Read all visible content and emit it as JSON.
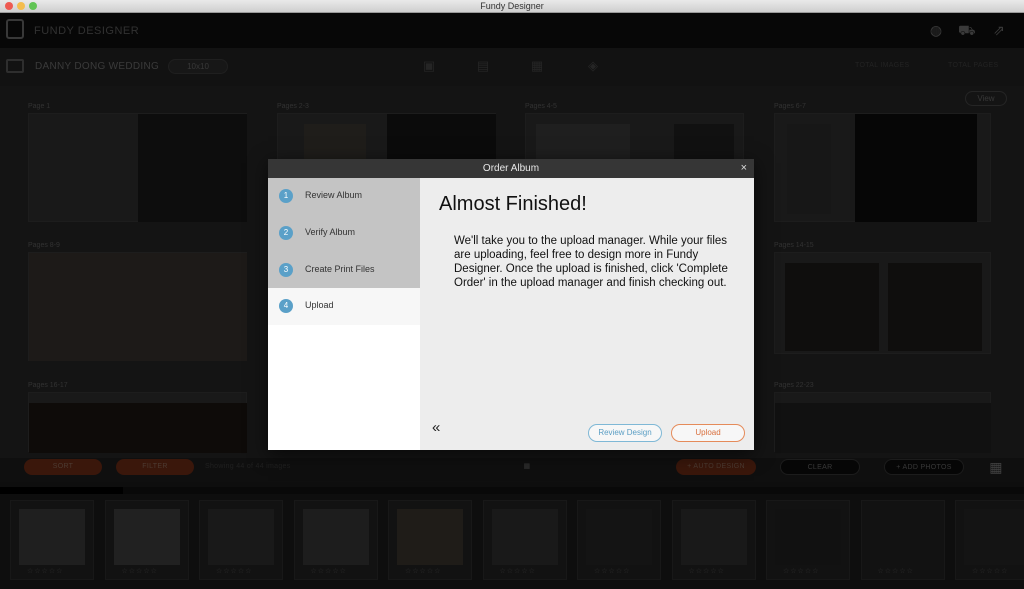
{
  "window": {
    "title": "Fundy Designer"
  },
  "appbar": {
    "brand": "FUNDY DESIGNER"
  },
  "project": {
    "name": "DANNY DONG WEDDING",
    "size": "10x10",
    "stats": [
      "TOTAL IMAGES",
      "TOTAL PAGES"
    ]
  },
  "workspace": {
    "view_label": "View",
    "spreads": [
      "Page 1",
      "Pages 2-3",
      "Pages 4-5",
      "Pages 6-7",
      "Pages 8-9",
      "Pages 14-15",
      "Pages 16-17",
      "Pages 22-23"
    ]
  },
  "actionbar": {
    "sort": "SORT",
    "filter": "FILTER",
    "showing": "Showing 44 of 44 images",
    "auto_design": "+ AUTO DESIGN",
    "clear": "CLEAR",
    "add_photos": "+ ADD PHOTOS"
  },
  "progress": {
    "fraction": 0.12
  },
  "filmstrip": {
    "count": 11,
    "stars": "☆☆☆☆☆"
  },
  "modal": {
    "title": "Order Album",
    "close": "×",
    "steps": [
      {
        "num": "1",
        "label": "Review Album",
        "state": "done"
      },
      {
        "num": "2",
        "label": "Verify Album",
        "state": "done"
      },
      {
        "num": "3",
        "label": "Create Print Files",
        "state": "done"
      },
      {
        "num": "4",
        "label": "Upload",
        "state": "current"
      }
    ],
    "heading": "Almost Finished!",
    "body": "We'll take you to the upload manager. While your files are uploading, feel free to design more in Fundy Designer. Once the upload is finished, click 'Complete Order' in the upload manager and finish checking out.",
    "back": "«",
    "review_button": "Review Design",
    "upload_button": "Upload"
  },
  "colors": {
    "step_accent": "#5aa0c8",
    "upload_accent": "#e58b5a",
    "review_accent": "#7fb8d6",
    "orange_pill": "#c0461e"
  }
}
